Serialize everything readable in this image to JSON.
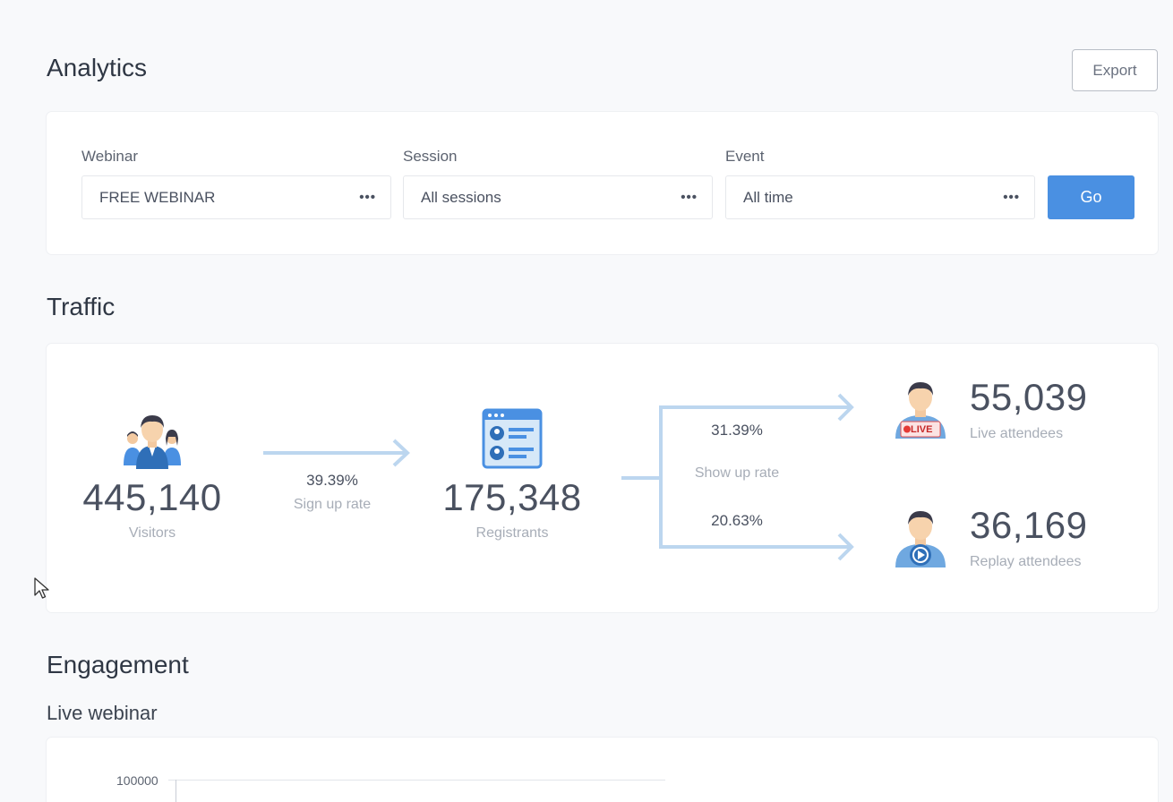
{
  "header": {
    "title": "Analytics",
    "export_label": "Export"
  },
  "filters": {
    "webinar": {
      "label": "Webinar",
      "value": "FREE WEBINAR"
    },
    "session": {
      "label": "Session",
      "value": "All sessions"
    },
    "event": {
      "label": "Event",
      "value": "All time"
    },
    "more_icon": "•••",
    "go_label": "Go"
  },
  "traffic": {
    "title": "Traffic",
    "visitors": {
      "value": "445,140",
      "label": "Visitors"
    },
    "signup": {
      "rate": "39.39%",
      "label": "Sign up rate"
    },
    "registrants": {
      "value": "175,348",
      "label": "Registrants"
    },
    "show_up": {
      "live_rate": "31.39%",
      "label": "Show up rate",
      "replay_rate": "20.63%"
    },
    "live": {
      "value": "55,039",
      "label": "Live attendees",
      "badge": "LIVE"
    },
    "replay": {
      "value": "36,169",
      "label": "Replay attendees"
    }
  },
  "engagement": {
    "title": "Engagement",
    "subtitle": "Live webinar",
    "axis_top": "100000"
  },
  "colors": {
    "accent": "#4a90e2",
    "arrow": "#bcd6ef",
    "live_badge": "#e53935"
  }
}
